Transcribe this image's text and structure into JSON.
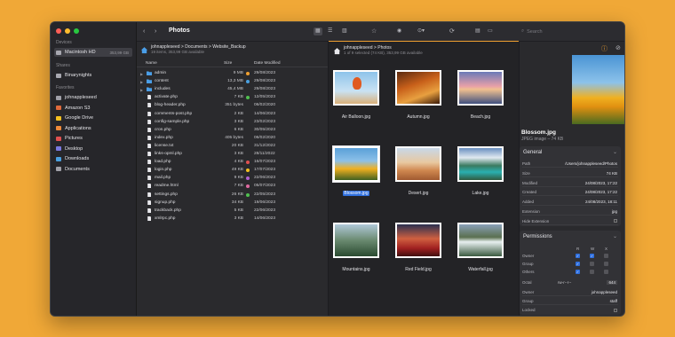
{
  "window": {
    "title": "Photos"
  },
  "search": {
    "placeholder": "Search"
  },
  "sidebar": {
    "devices_label": "Devices",
    "devices": [
      {
        "label": "Macintosh HD",
        "size": "353,99 GB"
      }
    ],
    "shares_label": "Shares",
    "shares": [
      {
        "label": "Binarynights"
      }
    ],
    "favorites_label": "Favorites",
    "favorites": [
      {
        "label": "johnappleseed",
        "icon": "home-icon",
        "color": "#a0a0a8"
      },
      {
        "label": "Amazon S3",
        "icon": "bucket-icon",
        "color": "#e06a3b"
      },
      {
        "label": "Google Drive",
        "icon": "gdrive-icon",
        "color": "#f4c020"
      },
      {
        "label": "Applications",
        "icon": "apps-icon",
        "color": "#f08a3a"
      },
      {
        "label": "Pictures",
        "icon": "pictures-icon",
        "color": "#e05050"
      },
      {
        "label": "Desktop",
        "icon": "desktop-icon",
        "color": "#7a7ae0"
      },
      {
        "label": "Downloads",
        "icon": "downloads-icon",
        "color": "#4aa0e0"
      },
      {
        "label": "Documents",
        "icon": "documents-icon",
        "color": "#a0a0a8"
      }
    ]
  },
  "left_pane": {
    "breadcrumb": "johnappleseed > Documents > Website_Backup",
    "subtitle": "19 items, 353,99 GB available",
    "columns": {
      "name": "Name",
      "size": "Size",
      "date": "Date Modified"
    },
    "rows": [
      {
        "name": "admin",
        "size": "9 MB",
        "date": "29/08/2023",
        "folder": true,
        "dot": "#f0a030"
      },
      {
        "name": "content",
        "size": "13,3 MB",
        "date": "29/08/2023",
        "folder": true,
        "dot": "#4aa0e0"
      },
      {
        "name": "includes",
        "size": "45,4 MB",
        "date": "29/08/2023",
        "folder": true,
        "dot": ""
      },
      {
        "name": "activate.php",
        "size": "7 KB",
        "date": "12/05/2023",
        "folder": false,
        "dot": "#50c050"
      },
      {
        "name": "blog-header.php",
        "size": "351 bytes",
        "date": "06/02/2020",
        "folder": false,
        "dot": ""
      },
      {
        "name": "comments-post.php",
        "size": "2 KB",
        "date": "14/06/2023",
        "folder": false,
        "dot": ""
      },
      {
        "name": "config-sample.php",
        "size": "3 KB",
        "date": "23/02/2023",
        "folder": false,
        "dot": ""
      },
      {
        "name": "cron.php",
        "size": "6 KB",
        "date": "30/05/2023",
        "folder": false,
        "dot": ""
      },
      {
        "name": "index.php",
        "size": "405 bytes",
        "date": "06/02/2020",
        "folder": false,
        "dot": ""
      },
      {
        "name": "license.txt",
        "size": "20 KB",
        "date": "31/12/2022",
        "folder": false,
        "dot": ""
      },
      {
        "name": "links-opml.php",
        "size": "3 KB",
        "date": "28/11/2022",
        "folder": false,
        "dot": ""
      },
      {
        "name": "load.php",
        "size": "4 KB",
        "date": "16/07/2023",
        "folder": false,
        "dot": "#e05050"
      },
      {
        "name": "login.php",
        "size": "49 KB",
        "date": "17/07/2023",
        "folder": false,
        "dot": "#f4c020"
      },
      {
        "name": "mail.php",
        "size": "9 KB",
        "date": "22/06/2023",
        "folder": false,
        "dot": "#b060d0"
      },
      {
        "name": "readme.html",
        "size": "7 KB",
        "date": "05/07/2023",
        "folder": false,
        "dot": "#e06aa0"
      },
      {
        "name": "settings.php",
        "size": "26 KB",
        "date": "22/05/2023",
        "folder": false,
        "dot": "#50c050"
      },
      {
        "name": "signup.php",
        "size": "34 KB",
        "date": "19/06/2023",
        "folder": false,
        "dot": ""
      },
      {
        "name": "trackback.php",
        "size": "5 KB",
        "date": "22/06/2023",
        "folder": false,
        "dot": ""
      },
      {
        "name": "xmlrpc.php",
        "size": "3 KB",
        "date": "14/06/2023",
        "folder": false,
        "dot": ""
      }
    ]
  },
  "mid_pane": {
    "breadcrumb": "johnappleseed > Photos",
    "subtitle": "1 of 9 selected (74 KB), 353,99 GB available",
    "items": [
      {
        "name": "Air Balloon.jpg",
        "selected": false,
        "bg": "linear-gradient(180deg,#8ec3ea 0%,#c9e2f3 60%,#d9b07a 100%)",
        "accent": "#e05a20"
      },
      {
        "name": "Autumn.jpg",
        "selected": false,
        "bg": "linear-gradient(160deg,#5a2a10 0%,#c8601a 40%,#e8a040 70%,#3a1a08 100%)",
        "accent": ""
      },
      {
        "name": "Beach.jpg",
        "selected": false,
        "bg": "linear-gradient(180deg,#6a7ab8 0%,#e8a0a8 45%,#f0c090 55%,#405080 100%)",
        "accent": ""
      },
      {
        "name": "Blossom.jpg",
        "selected": true,
        "bg": "linear-gradient(180deg,#5aa0d8 0%,#8cc0e8 40%,#f0b020 65%,#406020 100%)",
        "accent": ""
      },
      {
        "name": "Desert.jpg",
        "selected": false,
        "bg": "linear-gradient(180deg,#c8d8e8 0%,#e8c8a0 45%,#d08850 70%,#a05a30 100%)",
        "accent": ""
      },
      {
        "name": "Lake.jpg",
        "selected": false,
        "bg": "linear-gradient(180deg,#6a90c0 0%,#e0e8f0 30%,#3a7a60 55%,#2ab0b0 75%,#305a40 100%)",
        "accent": ""
      },
      {
        "name": "Mountains.jpg",
        "selected": false,
        "bg": "linear-gradient(180deg,#b0c8d8 0%,#6a8a70 50%,#2a4a30 100%)",
        "accent": ""
      },
      {
        "name": "Red Field.jpg",
        "selected": false,
        "bg": "linear-gradient(180deg,#2a3050 0%,#d06040 45%,#a02020 75%,#401010 100%)",
        "accent": ""
      },
      {
        "name": "Waterfall.jpg",
        "selected": false,
        "bg": "linear-gradient(180deg,#8aa0b8 0%,#5a7050 40%,#e8f0f0 55%,#3a5a40 100%)",
        "accent": ""
      }
    ]
  },
  "right_pane": {
    "file_name": "Blossom.jpg",
    "file_kind": "JPEG image – 74 KB",
    "general_label": "General",
    "general": [
      {
        "k": "Path",
        "v": "/Users/johnappleseed/Photos"
      },
      {
        "k": "Size",
        "v": "74 KB"
      },
      {
        "k": "Modified",
        "v": "24/08/2023, 17:22"
      },
      {
        "k": "Created",
        "v": "24/08/2023, 17:22"
      },
      {
        "k": "Added",
        "v": "24/08/2023, 18:11"
      },
      {
        "k": "Extension",
        "v": "jpg"
      },
      {
        "k": "Hide Extension",
        "v": ""
      }
    ],
    "permissions_label": "Permissions",
    "perm_cols": [
      "R",
      "W",
      "X"
    ],
    "perm_rows": [
      {
        "k": "Owner",
        "r": true,
        "w": true,
        "x": false
      },
      {
        "k": "Group",
        "r": true,
        "w": false,
        "x": false
      },
      {
        "k": "Others",
        "r": true,
        "w": false,
        "x": false
      }
    ],
    "octal_label": "Octal",
    "octal_text": "rw-r--r--",
    "octal_value": "644",
    "owner_label": "Owner",
    "owner_value": "johnappleseed",
    "group_label": "Group",
    "group_value": "staff",
    "locked_label": "Locked"
  }
}
